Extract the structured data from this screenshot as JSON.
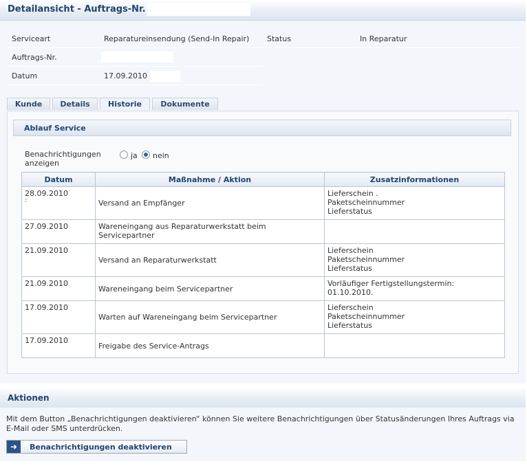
{
  "header": {
    "title": "Detailansicht - Auftrags-Nr."
  },
  "info": {
    "serviceart_label": "Serviceart",
    "serviceart_value": "Reparatureinsendung (Send-In Repair)",
    "status_label": "Status",
    "status_value": "In Reparatur",
    "auftrag_label": "Auftrags-Nr.",
    "datum_label": "Datum",
    "datum_value": "17.09.2010"
  },
  "tabs": [
    {
      "label": "Kunde"
    },
    {
      "label": "Details"
    },
    {
      "label": "Historie",
      "active": true
    },
    {
      "label": "Dokumente"
    }
  ],
  "section": {
    "title": "Ablauf Service"
  },
  "notifications": {
    "label": "Benachrichtigungen anzeigen",
    "option_yes": "ja",
    "option_no": "nein",
    "selected": "nein"
  },
  "history": {
    "columns": [
      "Datum",
      "Maßnahme / Aktion",
      "Zusatzinformationen"
    ],
    "rows": [
      {
        "date": "28.09.2010",
        "date_extra": ":",
        "action": "Versand an Empfänger",
        "info": [
          "Lieferschein .",
          "Paketscheinnummer",
          "Lieferstatus"
        ]
      },
      {
        "date": "27.09.2010",
        "date_extra": "",
        "action": "Wareneingang aus Reparaturwerkstatt beim Servicepartner",
        "info": []
      },
      {
        "date": "21.09.2010",
        "date_extra": "",
        "action": "Versand an Reparaturwerkstatt",
        "info": [
          "Lieferschein",
          "Paketscheinnummer",
          "Lieferstatus"
        ]
      },
      {
        "date": "21.09.2010",
        "date_extra": "",
        "action": "Wareneingang beim Servicepartner",
        "info": [
          "Vorläufiger Fertigstellungstermin:",
          "01.10.2010."
        ]
      },
      {
        "date": "17.09.2010",
        "date_extra": "",
        "action": "Warten auf Wareneingang beim Servicepartner",
        "info": [
          "Lieferschein",
          "Paketscheinnummer",
          "Lieferstatus"
        ]
      },
      {
        "date": "17.09.2010",
        "date_extra": "",
        "action": "Freigabe des Service-Antrags",
        "info": []
      }
    ]
  },
  "aktionen": {
    "title": "Aktionen",
    "text": "Mit dem Button „Benachrichtigungen deaktivieren“ können Sie weitere Benachrichtigungen über Statusänderungen Ihres Auftrags via E-Mail oder SMS unterdrücken.",
    "button_label": "Benachrichtigungen deaktivieren",
    "button_icon": "arrow-right-icon"
  }
}
